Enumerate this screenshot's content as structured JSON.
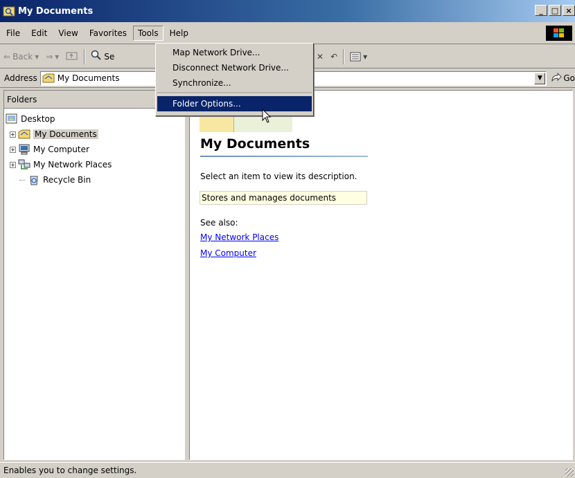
{
  "window": {
    "title": "My Documents",
    "controls": [
      "_",
      "□",
      "×"
    ]
  },
  "menubar": {
    "items": [
      {
        "label": "File"
      },
      {
        "label": "Edit"
      },
      {
        "label": "View"
      },
      {
        "label": "Favorites"
      },
      {
        "label": "Tools"
      },
      {
        "label": "Help"
      }
    ]
  },
  "toolbar": {
    "back_label": "Back",
    "search_label": "Se"
  },
  "address": {
    "label": "Address",
    "value": "My Documents",
    "go_label": "Go"
  },
  "folders": {
    "header": "Folders",
    "tree": [
      {
        "label": "Desktop"
      },
      {
        "label": "My Documents"
      },
      {
        "label": "My Computer"
      },
      {
        "label": "My Network Places"
      },
      {
        "label": "Recycle Bin"
      }
    ]
  },
  "content": {
    "title": "My Documents",
    "description": "Select an item to view its description.",
    "info": "Stores and manages documents",
    "see_also": "See also:",
    "links": [
      "My Network Places",
      "My Computer"
    ]
  },
  "tools_menu": {
    "items": [
      {
        "label": "Map Network Drive..."
      },
      {
        "label": "Disconnect Network Drive..."
      },
      {
        "label": "Synchronize..."
      },
      {
        "label": "Folder Options..."
      }
    ],
    "highlighted": "Folder Options..."
  },
  "status": {
    "text": "Enables you to change settings."
  },
  "colors": {
    "title_bar": "#0a246a",
    "highlight": "#0a246a",
    "link": "#0000ff",
    "info_bg": "#ffffe1"
  }
}
